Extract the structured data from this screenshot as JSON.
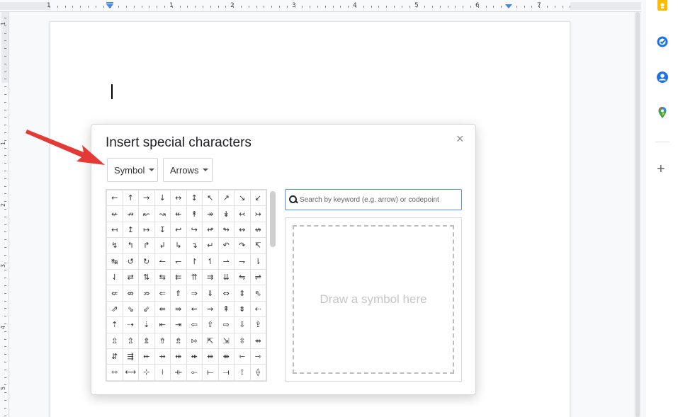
{
  "ruler": {
    "numbers": [
      "1",
      "1",
      "2",
      "3",
      "4",
      "5",
      "6",
      "7"
    ]
  },
  "vruler": {
    "numbers": [
      "1",
      "1",
      "2",
      "3",
      "4",
      "5"
    ]
  },
  "side_panel": {
    "icons": [
      "keep-icon",
      "tasks-icon",
      "contacts-icon",
      "maps-icon"
    ],
    "add_label": "+"
  },
  "dialog": {
    "title": "Insert special characters",
    "close_label": "×",
    "category_dropdown": "Symbol",
    "subcategory_dropdown": "Arrows",
    "search_placeholder": "Search by keyword (e.g. arrow) or codepoint",
    "draw_hint": "Draw a symbol here",
    "symbols": [
      [
        "←",
        "↑",
        "→",
        "↓",
        "↔",
        "↕",
        "↖",
        "↗",
        "↘",
        "↙"
      ],
      [
        "↚",
        "↛",
        "↜",
        "↝",
        "↞",
        "↟",
        "↠",
        "↡",
        "↢",
        "↣"
      ],
      [
        "↤",
        "↥",
        "↦",
        "↧",
        "↩",
        "↪",
        "↫",
        "↬",
        "↭",
        "↮"
      ],
      [
        "↯",
        "↰",
        "↱",
        "↲",
        "↳",
        "↴",
        "↵",
        "↶",
        "↷",
        "↸"
      ],
      [
        "↹",
        "↺",
        "↻",
        "↼",
        "↽",
        "↾",
        "↿",
        "⇀",
        "⇁",
        "⇂"
      ],
      [
        "⇃",
        "⇄",
        "⇅",
        "⇆",
        "⇇",
        "⇈",
        "⇉",
        "⇊",
        "⇋",
        "⇌"
      ],
      [
        "⇍",
        "⇎",
        "⇏",
        "⇐",
        "⇑",
        "⇒",
        "⇓",
        "⇔",
        "⇕",
        "⇖"
      ],
      [
        "⇗",
        "⇘",
        "⇙",
        "⇚",
        "⇛",
        "⇜",
        "⇝",
        "⇞",
        "⇟",
        "⇠"
      ],
      [
        "⇡",
        "⇢",
        "⇣",
        "⇤",
        "⇥",
        "⇦",
        "⇧",
        "⇨",
        "⇩",
        "⇪"
      ],
      [
        "⇫",
        "⇬",
        "⇭",
        "⇮",
        "⇯",
        "⇰",
        "⇱",
        "⇲",
        "⇳",
        "⇴"
      ],
      [
        "⇵",
        "⇶",
        "⇷",
        "⇸",
        "⇹",
        "⇺",
        "⇻",
        "⇼",
        "⇽",
        "⇾"
      ],
      [
        "⇿",
        "⟷",
        "⊹",
        "⟊",
        "⟛",
        "⟜",
        "⟝",
        "⟞",
        "⟟",
        "⟠"
      ]
    ]
  },
  "colors": {
    "annotation_arrow": "#e53935",
    "accent": "#4285f4",
    "focus_border": "#4d90fe"
  }
}
